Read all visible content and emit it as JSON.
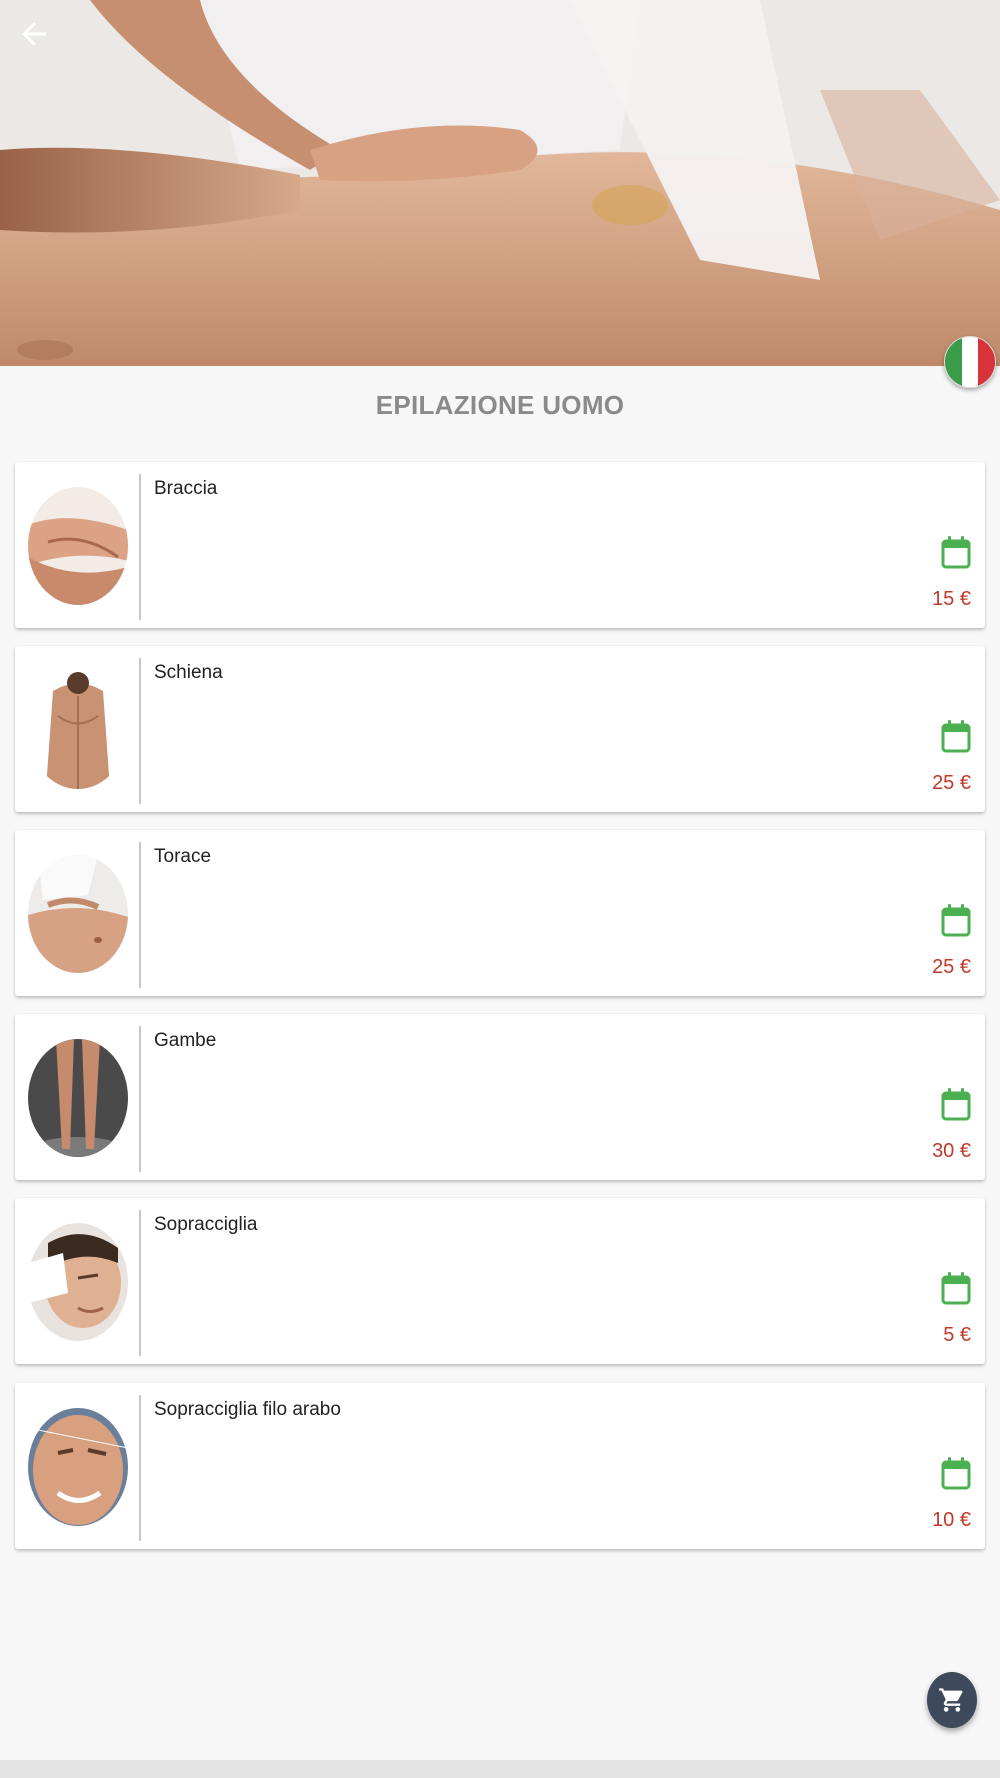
{
  "header": {
    "back_icon": "arrow-left-icon",
    "language_flag": "italy-flag-icon"
  },
  "page": {
    "title": "EPILAZIONE UOMO"
  },
  "services": [
    {
      "name": "Braccia",
      "price": "15 €",
      "thumb": "arms-photo",
      "booking_icon": "calendar-icon"
    },
    {
      "name": "Schiena",
      "price": "25 €",
      "thumb": "back-photo",
      "booking_icon": "calendar-icon"
    },
    {
      "name": "Torace",
      "price": "25 €",
      "thumb": "chest-photo",
      "booking_icon": "calendar-icon"
    },
    {
      "name": "Gambe",
      "price": "30 €",
      "thumb": "legs-photo",
      "booking_icon": "calendar-icon"
    },
    {
      "name": "Sopracciglia",
      "price": "5 €",
      "thumb": "eyebrows-photo",
      "booking_icon": "calendar-icon"
    },
    {
      "name": "Sopracciglia filo arabo",
      "price": "10 €",
      "thumb": "eyebrows-thread-photo",
      "booking_icon": "calendar-icon"
    }
  ],
  "cart": {
    "icon": "cart-icon"
  },
  "colors": {
    "accent_green": "#4caf50",
    "price_red": "#c0392b",
    "title_gray": "#8a8a8a",
    "fab_bg": "#3e4a5c"
  }
}
